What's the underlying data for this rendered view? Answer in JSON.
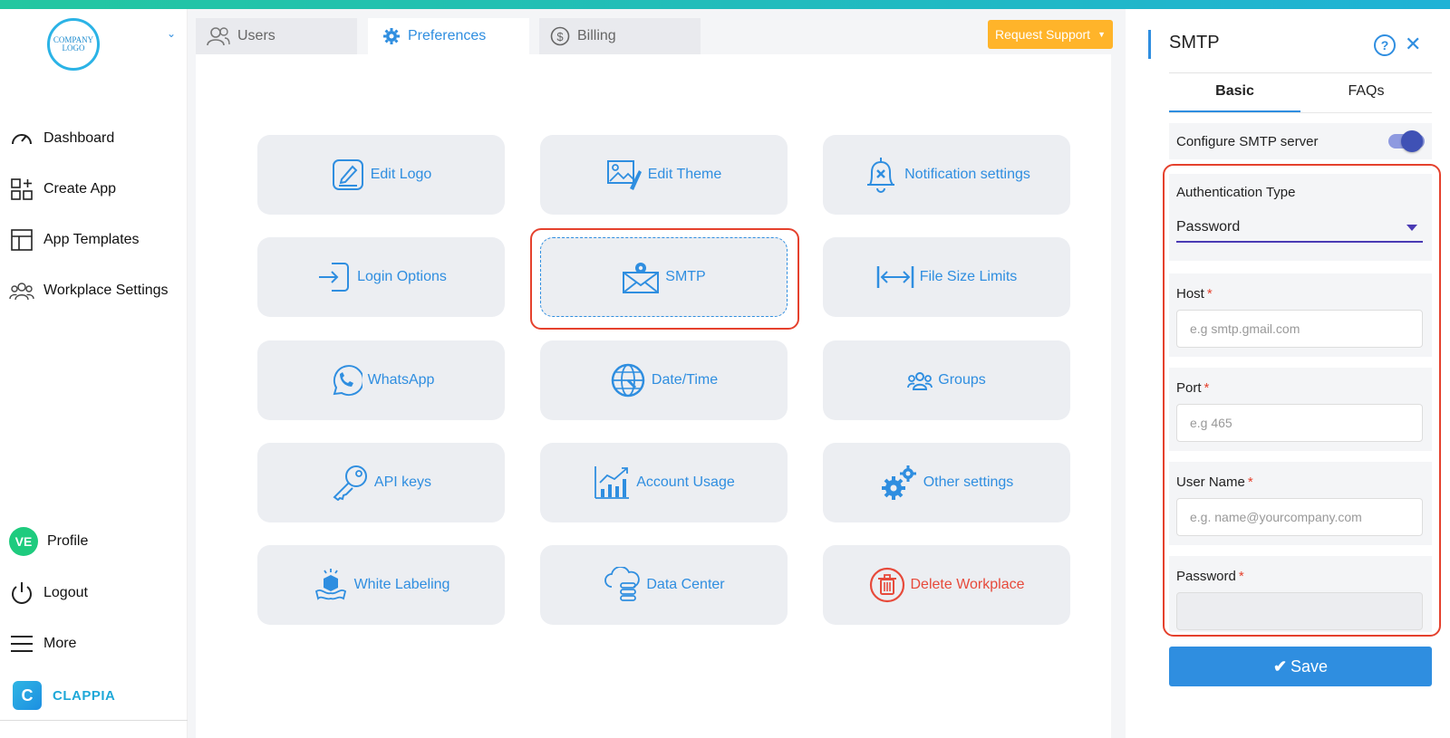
{
  "sidebar": {
    "logo_line1": "COMPANY",
    "logo_line2": "LOGO",
    "items": [
      {
        "label": "Dashboard",
        "icon": "gauge-icon"
      },
      {
        "label": "Create App",
        "icon": "grid-plus-icon"
      },
      {
        "label": "App Templates",
        "icon": "template-icon"
      },
      {
        "label": "Workplace Settings",
        "icon": "users-icon"
      }
    ],
    "profile": {
      "initials": "VE",
      "label": "Profile"
    },
    "logout_label": "Logout",
    "more_label": "More",
    "brand": {
      "letter": "C",
      "name": "CLAPPIA"
    }
  },
  "tabs": [
    {
      "label": "Users",
      "icon": "users-icon"
    },
    {
      "label": "Preferences",
      "icon": "gear-icon",
      "active": true
    },
    {
      "label": "Billing",
      "icon": "dollar-icon"
    }
  ],
  "support_button": "Request Support",
  "tiles": [
    {
      "label": "Edit Logo",
      "icon": "edit-logo-icon"
    },
    {
      "label": "Edit Theme",
      "icon": "theme-icon"
    },
    {
      "label": "Notification settings",
      "icon": "bell-icon"
    },
    {
      "label": "Login Options",
      "icon": "login-icon"
    },
    {
      "label": "SMTP",
      "icon": "mail-gear-icon",
      "selected": true
    },
    {
      "label": "File Size Limits",
      "icon": "arrows-icon"
    },
    {
      "label": "WhatsApp",
      "icon": "whatsapp-icon"
    },
    {
      "label": "Date/Time",
      "icon": "globe-clock-icon"
    },
    {
      "label": "Groups",
      "icon": "groups-icon"
    },
    {
      "label": "API keys",
      "icon": "key-icon"
    },
    {
      "label": "Account Usage",
      "icon": "chart-icon"
    },
    {
      "label": "Other settings",
      "icon": "gears-icon"
    },
    {
      "label": "White Labeling",
      "icon": "box-icon"
    },
    {
      "label": "Data Center",
      "icon": "cloud-db-icon"
    },
    {
      "label": "Delete Workplace",
      "icon": "trash-icon",
      "danger": true
    }
  ],
  "panel": {
    "title": "SMTP",
    "help": "?",
    "close": "✕",
    "tabs": [
      "Basic",
      "FAQs"
    ],
    "configure_label": "Configure SMTP server",
    "configure_on": true,
    "auth": {
      "label": "Authentication Type",
      "value": "Password"
    },
    "host": {
      "label": "Host",
      "placeholder": "e.g smtp.gmail.com"
    },
    "port": {
      "label": "Port",
      "placeholder": "e.g 465"
    },
    "username": {
      "label": "User Name",
      "placeholder": "e.g. name@yourcompany.com"
    },
    "password": {
      "label": "Password",
      "placeholder": ""
    },
    "required_mark": "*",
    "save_label": "Save"
  },
  "colors": {
    "accent": "#2f8ee0",
    "danger": "#e74a3b",
    "support": "#ffb42a",
    "avatar": "#1ecb7e"
  }
}
